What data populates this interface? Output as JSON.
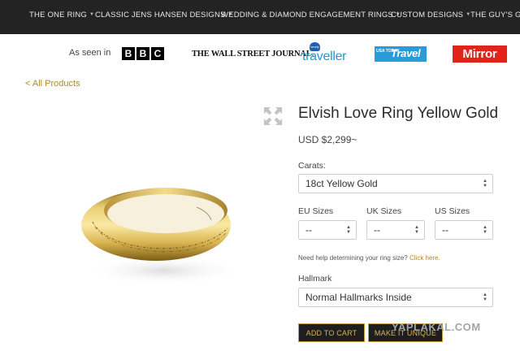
{
  "nav": {
    "items": [
      "THE ONE RING",
      "CLASSIC JENS HANSEN DESIGNS",
      "WEDDING & DIAMOND ENGAGEMENT RINGS",
      "CUSTOM DESIGNS",
      "THE GUY'S GUID"
    ]
  },
  "press": {
    "label": "As seen in",
    "logos": {
      "bbc": [
        "B",
        "B",
        "C"
      ],
      "wsj": "THE WALL STREET JOURNAL.",
      "traveller": "traveller",
      "traveller_badge": "lonely planet",
      "usa_small": "USA TODAY",
      "usa_big": "Travel",
      "mirror": "Mirror"
    }
  },
  "breadcrumb": {
    "back": "< All Products"
  },
  "product": {
    "title": "Elvish Love Ring Yellow Gold",
    "price": "USD $2,299~",
    "carats_label": "Carats:",
    "carats_value": "18ct Yellow Gold",
    "eu_label": "EU Sizes",
    "uk_label": "UK Sizes",
    "us_label": "US Sizes",
    "eu_value": "--",
    "uk_value": "--",
    "us_value": "--",
    "help_text": "Need help determining your ring size?",
    "help_link": "Click here.",
    "hallmark_label": "Hallmark",
    "hallmark_value": "Normal Hallmarks Inside",
    "add_to_cart": "ADD TO CART",
    "make_unique": "MAKE IT UNIQUE"
  },
  "watermark": "YAPLAKAL.COM",
  "colors": {
    "gold_link": "#b08a2e",
    "nav_bg": "#232323",
    "button_bg": "#1e1e1e",
    "button_border": "#c89b3c"
  },
  "icons": {
    "expand": "expand-arrows-icon",
    "dropdown": "chevron-updown-icon"
  }
}
